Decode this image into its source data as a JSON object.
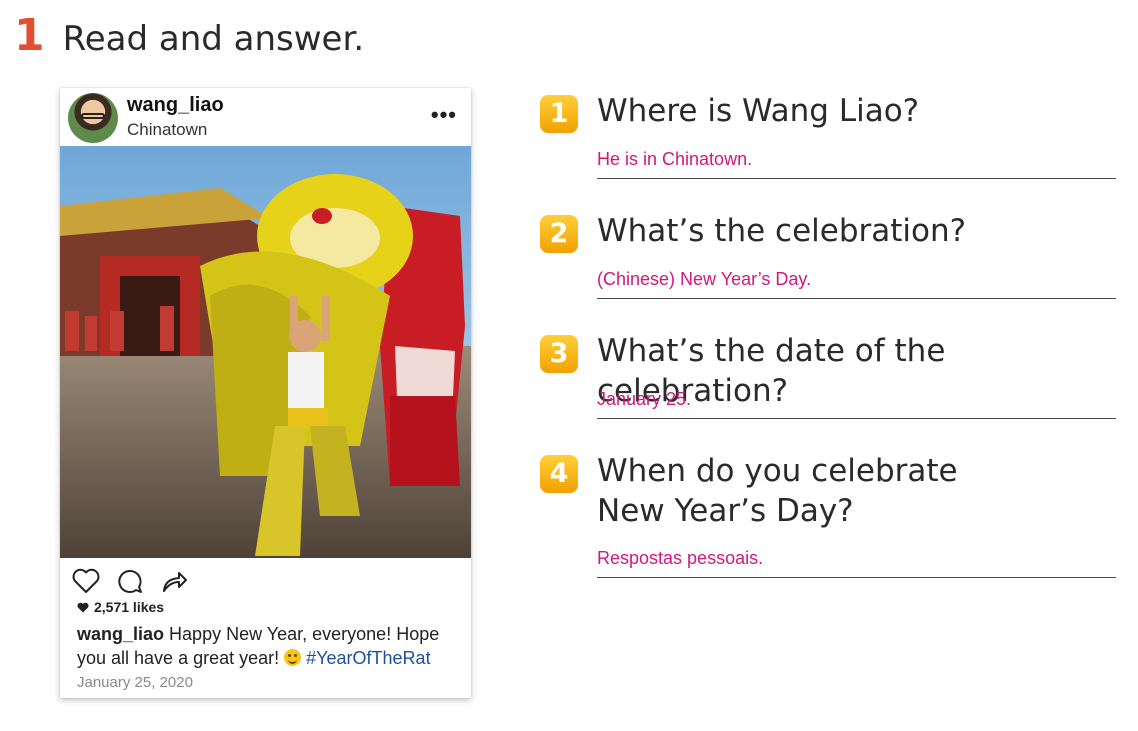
{
  "exercise": {
    "number": "1",
    "title": "Read and answer."
  },
  "post": {
    "username": "wang_liao",
    "location": "Chinatown",
    "menu_icon": "more-dots-icon",
    "likes": "2,571 likes",
    "caption_user": "wang_liao",
    "caption_text": "Happy New Year, everyone! Hope you all have a great year!",
    "hashtag": "#YearOfTheRat",
    "date": "January 25, 2020",
    "icons": [
      "heart-icon",
      "comment-icon",
      "share-icon"
    ]
  },
  "questions": [
    {
      "number": "1",
      "question": "Where is Wang Liao?",
      "answer": "He is in Chinatown."
    },
    {
      "number": "2",
      "question": "What’s the celebration?",
      "answer": "(Chinese) New Year’s Day."
    },
    {
      "number": "3",
      "question": "What’s the date of the celebration?",
      "answer": "January 25."
    },
    {
      "number": "4",
      "question": "When do you celebrate New Year’s Day?",
      "answer": "Respostas pessoais."
    }
  ],
  "colors": {
    "exercise_number": "#e0502f",
    "badge": "#f7b500",
    "answer": "#d1187b",
    "hashtag": "#1d4f9c"
  }
}
